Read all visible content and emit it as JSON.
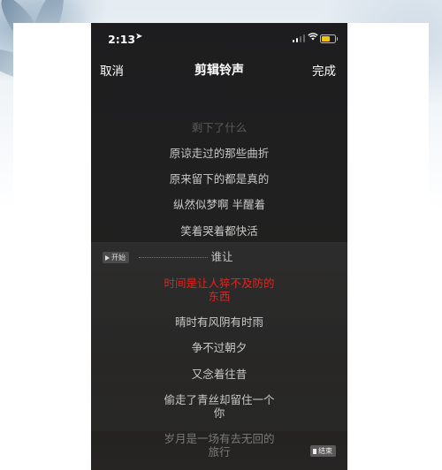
{
  "status_bar": {
    "time": "2:13",
    "location_icon": "location-arrow-icon",
    "signal_bars": 4,
    "signal_filled": 2,
    "battery_color": "#f1c40f"
  },
  "nav": {
    "cancel_label": "取消",
    "title": "剪辑铃声",
    "done_label": "完成"
  },
  "lyrics": [
    "剩下了什么",
    "原谅走过的那些曲折",
    "原来留下的都是真的",
    "纵然似梦啊 半醒着",
    "笑着哭着都快活",
    "谁让",
    "时间是让人猝不及防的",
    "东西",
    "晴时有风阴有时雨",
    "争不过朝夕",
    "又念着往昔",
    "偷走了青丝却留住一个",
    "你",
    "岁月是一场有去无回的",
    "旅行"
  ],
  "markers": {
    "start_label": "开始",
    "end_label": "结束"
  },
  "colors": {
    "active_lyric": "#e8211c",
    "background": "#1f1f1f"
  }
}
